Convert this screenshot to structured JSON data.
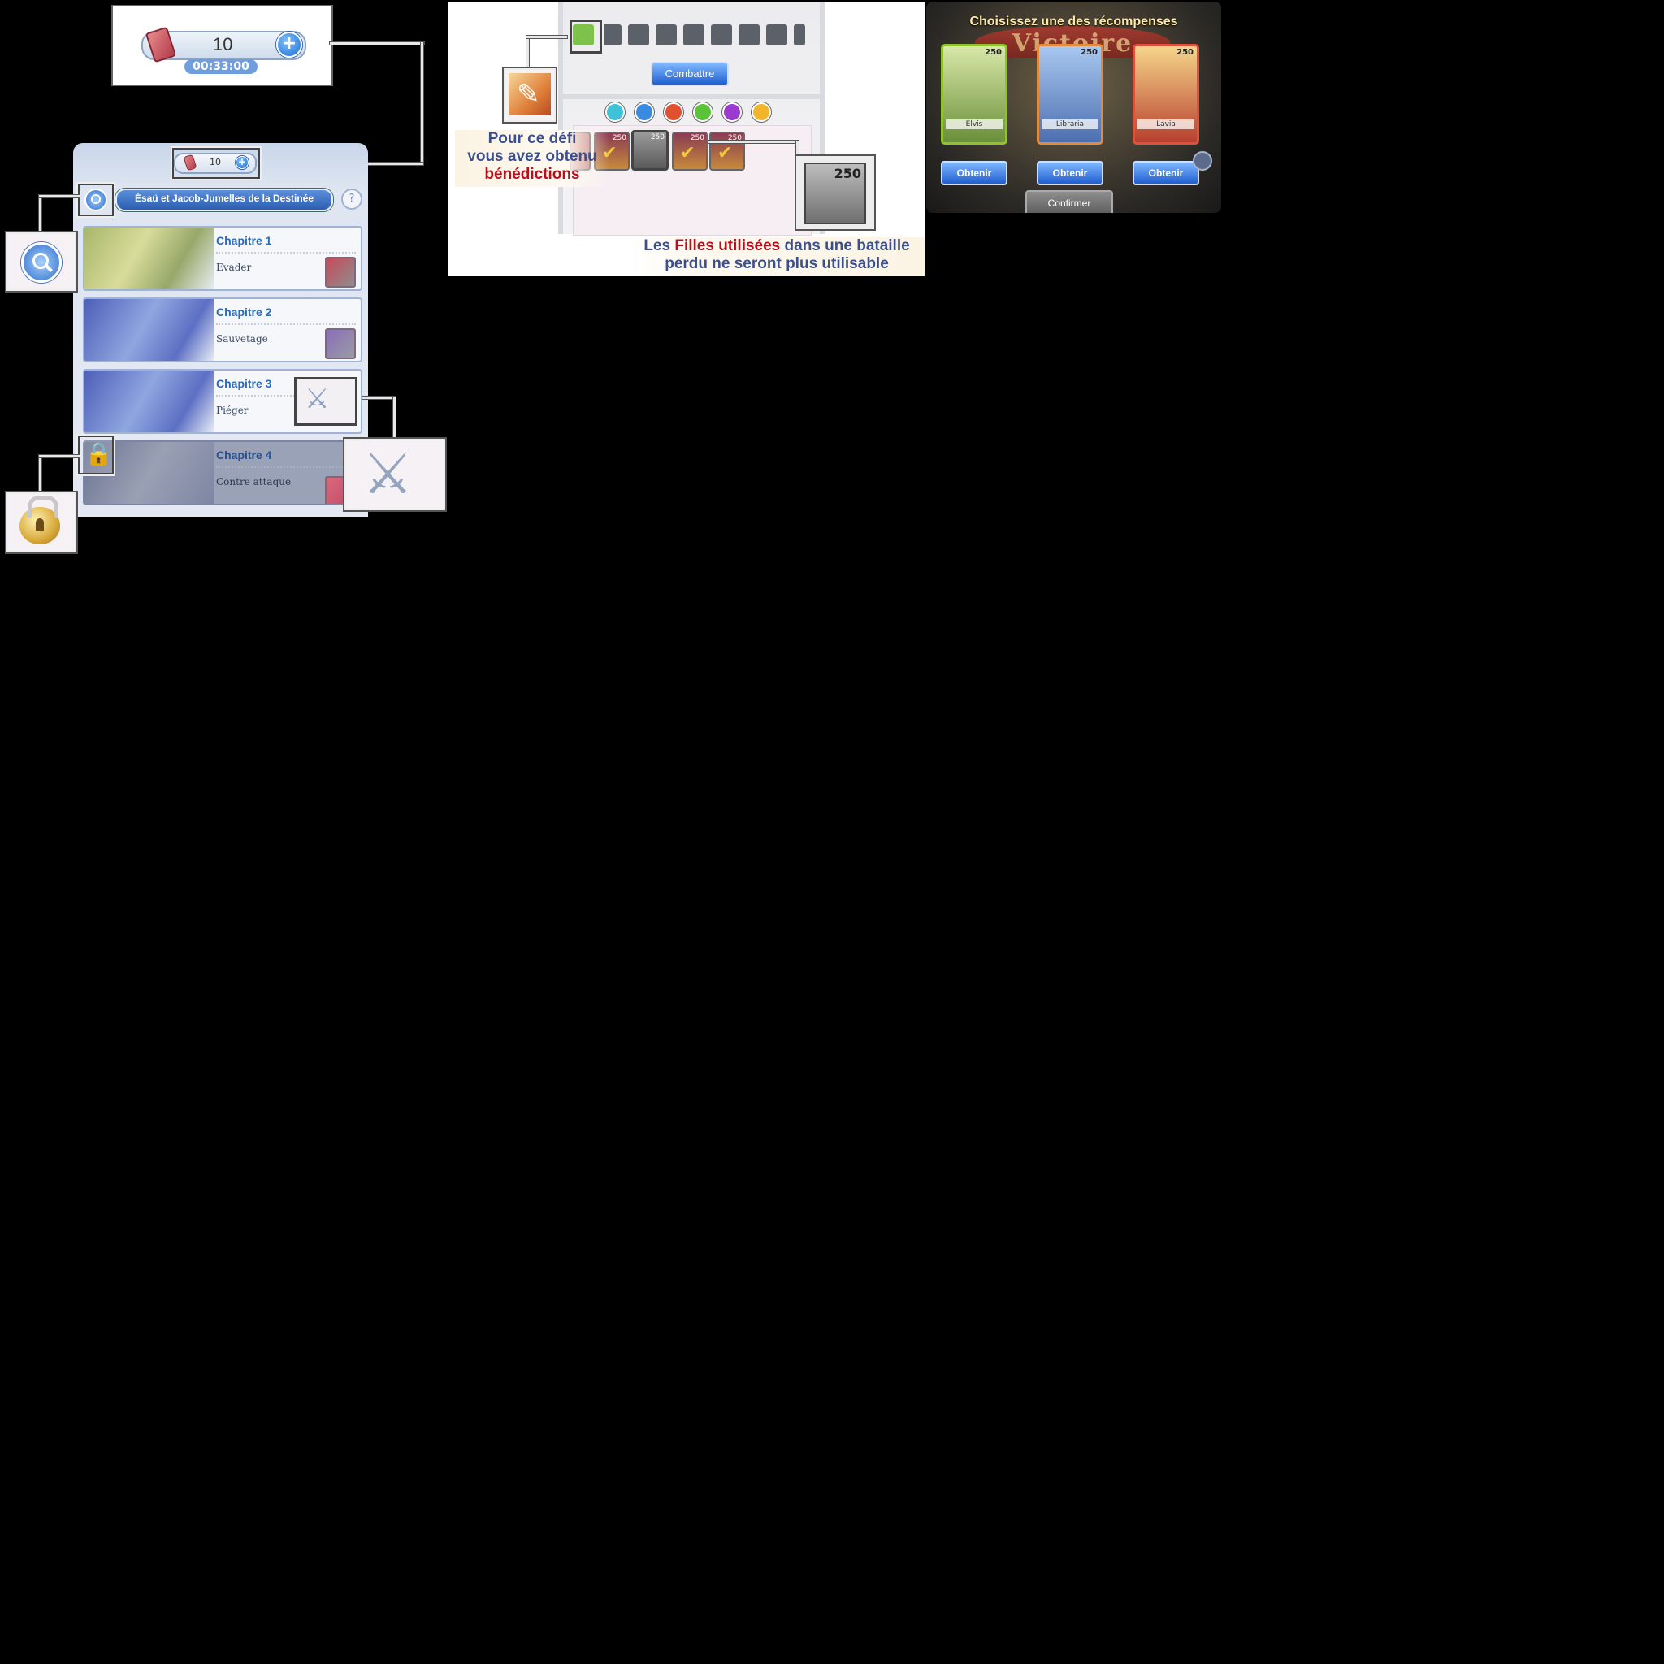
{
  "stamina": {
    "count": "10",
    "timer": "00:33:00",
    "plus": "+"
  },
  "panel": {
    "mini_count": "10",
    "title": "Ésaü et Jacob-Jumelles de la Destinée",
    "help": "?",
    "chapters": [
      {
        "title": "Chapitre 1",
        "subtitle": "Evader"
      },
      {
        "title": "Chapitre 2",
        "subtitle": "Sauvetage"
      },
      {
        "title": "Chapitre 3",
        "subtitle": "Piéger"
      },
      {
        "title": "Chapitre 4",
        "subtitle": "Contre attaque"
      }
    ]
  },
  "blessing": {
    "fight_label": "Combattre",
    "caption_line1": "Pour ce défi",
    "caption_line2": "vous avez obtenu",
    "caption_line3": "bénédictions",
    "bottom_pre": "Les ",
    "bottom_red": "Filles utilisées",
    "bottom_post": " dans une bataille",
    "bottom_line2": "perdu ne seront plus utilisable",
    "card_values": [
      "250",
      "250",
      "250",
      "250"
    ],
    "zoom_value": "250"
  },
  "reward": {
    "heading": "Choisissez une des récompenses",
    "banner": "Victoire",
    "cards": [
      {
        "name": "Elvis",
        "value": "250",
        "color": "#8fc22b"
      },
      {
        "name": "Libraria",
        "value": "250",
        "color": "#e48a3b"
      },
      {
        "name": "Lavia",
        "value": "250",
        "color": "#e0503b"
      }
    ],
    "obtain_label": "Obtenir",
    "confirm_label": "Confirmer"
  }
}
